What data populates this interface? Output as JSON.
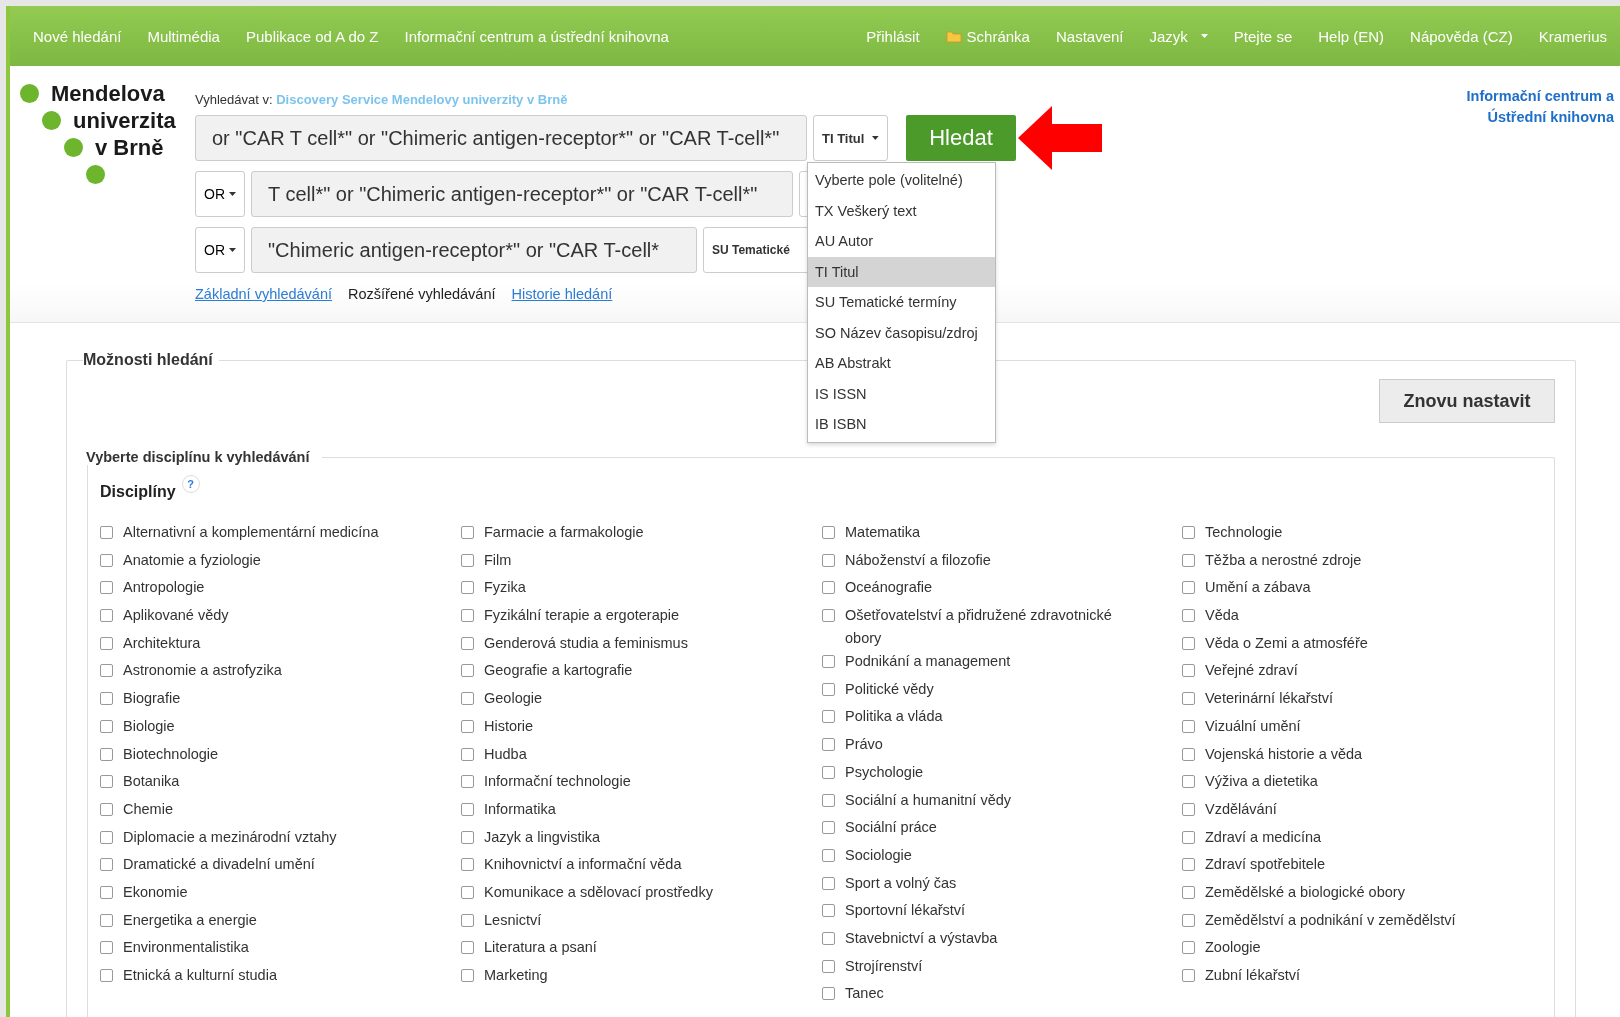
{
  "nav": {
    "left": [
      "Nové hledání",
      "Multimédia",
      "Publikace od A do Z",
      "Informační centrum a ústřední knihovna"
    ],
    "right": [
      {
        "label": "Přihlásit",
        "kind": "link"
      },
      {
        "label": "Schránka",
        "kind": "folder"
      },
      {
        "label": "Nastavení",
        "kind": "link"
      },
      {
        "label": "Jazyk",
        "kind": "menu"
      },
      {
        "label": "Ptejte se",
        "kind": "link"
      },
      {
        "label": "Help (EN)",
        "kind": "link"
      },
      {
        "label": "Nápověda (CZ)",
        "kind": "link"
      },
      {
        "label": "Kramerius",
        "kind": "link"
      }
    ]
  },
  "logo": {
    "lines": [
      "Mendelova",
      "univerzita",
      "v Brně"
    ]
  },
  "search": {
    "scope_label": "Vyhledávat v:",
    "scope": "Discovery Service Mendelovy univerzity v Brně",
    "rows": [
      {
        "operator": "",
        "query": "or \"CAR T cell*\" or \"Chimeric antigen-receptor*\" or \"CAR T-cell*\"",
        "field": "TI Titul"
      },
      {
        "operator": "OR",
        "query": "T cell*\" or \"Chimeric antigen-receptor*\" or \"CAR T-cell*\"",
        "field": ""
      },
      {
        "operator": "OR",
        "query": "\"Chimeric antigen-receptor*\" or \"CAR T-cell*",
        "field": "SU Tematické"
      }
    ],
    "button": "Hledat",
    "links": [
      {
        "label": "Základní vyhledávání",
        "selected": false
      },
      {
        "label": "Rozšířené vyhledávání",
        "selected": true
      },
      {
        "label": "Historie hledání",
        "selected": false
      }
    ],
    "dropdown": [
      {
        "label": "Vyberte pole (volitelné)",
        "selected": false
      },
      {
        "label": "TX Veškerý text",
        "selected": false
      },
      {
        "label": "AU Autor",
        "selected": false
      },
      {
        "label": "TI Titul",
        "selected": true
      },
      {
        "label": "SU Tematické termíny",
        "selected": false
      },
      {
        "label": "SO Název časopisu/zdroj",
        "selected": false
      },
      {
        "label": "AB Abstrakt",
        "selected": false
      },
      {
        "label": "IS ISSN",
        "selected": false
      },
      {
        "label": "IB ISBN",
        "selected": false
      }
    ]
  },
  "library_link": "Informační centrum a Ústřední knihovna",
  "options": {
    "title": "Možnosti hledání",
    "reset": "Znovu nastavit",
    "section": "Vyberte disciplínu k vyhledávání",
    "heading": "Disciplíny",
    "help": "?",
    "columns": [
      [
        {
          "label": "Alternativní a komplementární medicína",
          "checked": false
        },
        {
          "label": "Anatomie a fyziologie",
          "checked": false
        },
        {
          "label": "Antropologie",
          "checked": false
        },
        {
          "label": "Aplikované vědy",
          "checked": false
        },
        {
          "label": "Architektura",
          "checked": false
        },
        {
          "label": "Astronomie a astrofyzika",
          "checked": false
        },
        {
          "label": "Biografie",
          "checked": false
        },
        {
          "label": "Biologie",
          "checked": false
        },
        {
          "label": "Biotechnologie",
          "checked": false
        },
        {
          "label": "Botanika",
          "checked": false
        },
        {
          "label": "Chemie",
          "checked": false
        },
        {
          "label": "Diplomacie a mezinárodní vztahy",
          "checked": false
        },
        {
          "label": "Dramatické a divadelní umění",
          "checked": false
        },
        {
          "label": "Ekonomie",
          "checked": false
        },
        {
          "label": "Energetika a energie",
          "checked": false
        },
        {
          "label": "Environmentalistika",
          "checked": false
        },
        {
          "label": "Etnická a kulturní studia",
          "checked": false
        }
      ],
      [
        {
          "label": "Farmacie a farmakologie",
          "checked": false
        },
        {
          "label": "Film",
          "checked": false
        },
        {
          "label": "Fyzika",
          "checked": false
        },
        {
          "label": "Fyzikální terapie a ergoterapie",
          "checked": false
        },
        {
          "label": "Genderová studia a feminismus",
          "checked": false
        },
        {
          "label": "Geografie a kartografie",
          "checked": false
        },
        {
          "label": "Geologie",
          "checked": false
        },
        {
          "label": "Historie",
          "checked": false
        },
        {
          "label": "Hudba",
          "checked": false
        },
        {
          "label": "Informační technologie",
          "checked": false
        },
        {
          "label": "Informatika",
          "checked": false
        },
        {
          "label": "Jazyk a lingvistika",
          "checked": false
        },
        {
          "label": "Knihovnictví a informační věda",
          "checked": false
        },
        {
          "label": "Komunikace a sdělovací prostředky",
          "checked": false
        },
        {
          "label": "Lesnictví",
          "checked": false
        },
        {
          "label": "Literatura a psaní",
          "checked": false
        },
        {
          "label": "Marketing",
          "checked": false
        }
      ],
      [
        {
          "label": "Matematika",
          "checked": false
        },
        {
          "label": "Náboženství a filozofie",
          "checked": false
        },
        {
          "label": "Oceánografie",
          "checked": false
        },
        {
          "label": "Ošetřovatelství a přidružené zdravotnické obory",
          "checked": false
        },
        {
          "label": "Podnikání a management",
          "checked": false
        },
        {
          "label": "Politické vědy",
          "checked": false
        },
        {
          "label": "Politika a vláda",
          "checked": false
        },
        {
          "label": "Právo",
          "checked": false
        },
        {
          "label": "Psychologie",
          "checked": false
        },
        {
          "label": "Sociální a humanitní vědy",
          "checked": false
        },
        {
          "label": "Sociální práce",
          "checked": false
        },
        {
          "label": "Sociologie",
          "checked": false
        },
        {
          "label": "Sport a volný čas",
          "checked": false
        },
        {
          "label": "Sportovní lékařství",
          "checked": false
        },
        {
          "label": "Stavebnictví a výstavba",
          "checked": false
        },
        {
          "label": "Strojírenství",
          "checked": false
        },
        {
          "label": "Tanec",
          "checked": false
        }
      ],
      [
        {
          "label": "Technologie",
          "checked": false
        },
        {
          "label": "Těžba a nerostné zdroje",
          "checked": false
        },
        {
          "label": "Umění a zábava",
          "checked": false
        },
        {
          "label": "Věda",
          "checked": false
        },
        {
          "label": "Věda o Zemi a atmosféře",
          "checked": false
        },
        {
          "label": "Veřejné zdraví",
          "checked": false
        },
        {
          "label": "Veterinární lékařství",
          "checked": false
        },
        {
          "label": "Vizuální umění",
          "checked": false
        },
        {
          "label": "Vojenská historie a věda",
          "checked": false
        },
        {
          "label": "Výživa a dietetika",
          "checked": false
        },
        {
          "label": "Vzdělávání",
          "checked": false
        },
        {
          "label": "Zdraví a medicína",
          "checked": false
        },
        {
          "label": "Zdraví spotřebitele",
          "checked": false
        },
        {
          "label": "Zemědělské a biologické obory",
          "checked": false
        },
        {
          "label": "Zemědělství a podnikání v zemědělství",
          "checked": false
        },
        {
          "label": "Zoologie",
          "checked": false
        },
        {
          "label": "Zubní lékařství",
          "checked": false
        }
      ]
    ]
  }
}
